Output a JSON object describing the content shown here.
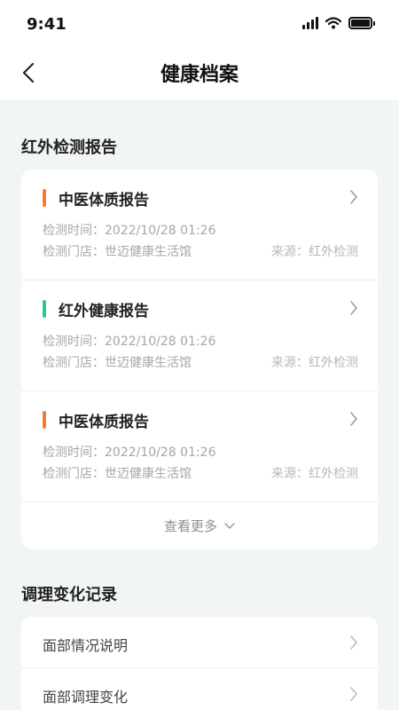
{
  "status": {
    "time": "9:41"
  },
  "nav": {
    "title": "健康档案"
  },
  "infrared_section": {
    "title": "红外检测报告",
    "reports": [
      {
        "title": "中医体质报告",
        "accent": "#f07c3a",
        "time_label": "检测时间：",
        "time": "2022/10/28 01:26",
        "store_label": "检测门店：",
        "store": "世迈健康生活馆",
        "source": "来源：红外检测"
      },
      {
        "title": "红外健康报告",
        "accent": "#2ec48e",
        "time_label": "检测时间：",
        "time": "2022/10/28 01:26",
        "store_label": "检测门店：",
        "store": "世迈健康生活馆",
        "source": "来源：红外检测"
      },
      {
        "title": "中医体质报告",
        "accent": "#f07c3a",
        "time_label": "检测时间：",
        "time": "2022/10/28 01:26",
        "store_label": "检测门店：",
        "store": "世迈健康生活馆",
        "source": "来源：红外检测"
      }
    ],
    "more_label": "查看更多"
  },
  "records_section": {
    "title": "调理变化记录",
    "items": [
      {
        "label": "面部情况说明"
      },
      {
        "label": "面部调理变化"
      }
    ]
  },
  "icons": {
    "back": "chevron-left-icon",
    "forward": "chevron-right-icon",
    "more": "chevron-down-icon",
    "signal": "cellular-signal-icon",
    "wifi": "wifi-icon",
    "battery": "battery-icon"
  }
}
